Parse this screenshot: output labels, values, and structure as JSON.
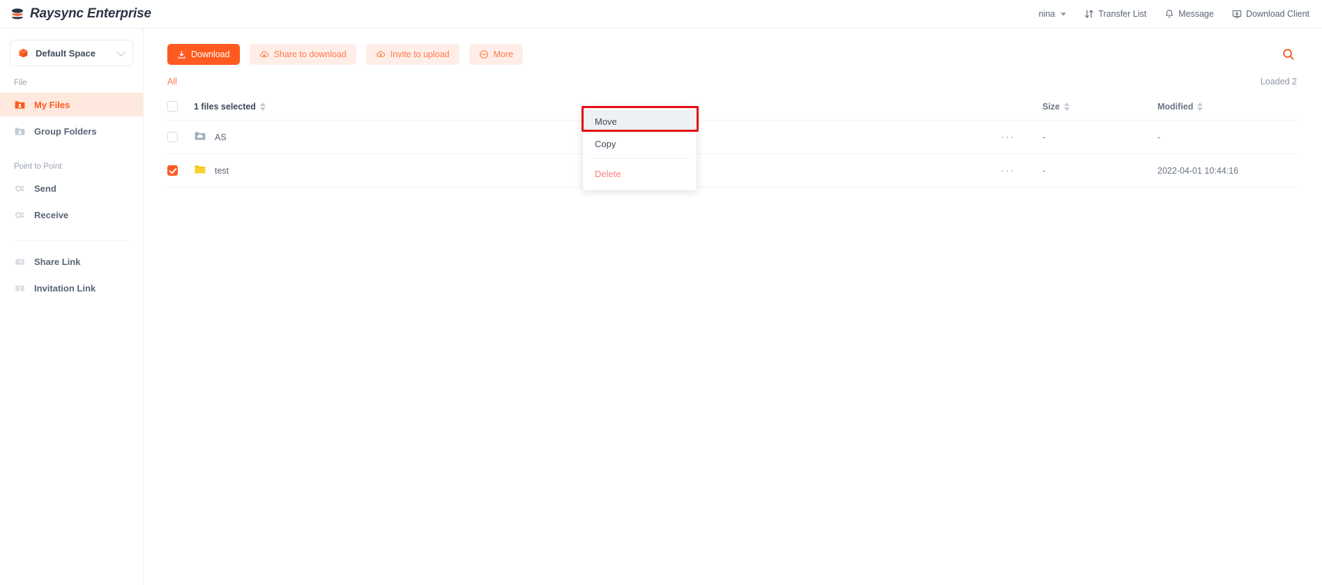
{
  "header": {
    "brand": "Raysync Enterprise",
    "brand_logo_icon": "raysync-stack-icon",
    "user": {
      "name": "nina",
      "caret_icon": "chevron-down-icon"
    },
    "nav": [
      {
        "label": "Transfer List",
        "icon": "transfer-arrows-icon"
      },
      {
        "label": "Message",
        "icon": "bell-icon"
      },
      {
        "label": "Download Client",
        "icon": "monitor-download-icon"
      }
    ]
  },
  "sidebar": {
    "space": {
      "label": "Default Space",
      "icon": "cube-icon",
      "caret_icon": "chevron-down-icon"
    },
    "sections": [
      {
        "label": "File",
        "items": [
          {
            "label": "My Files",
            "icon": "folder-user-icon",
            "active": true
          },
          {
            "label": "Group Folders",
            "icon": "folder-group-icon",
            "active": false
          }
        ]
      },
      {
        "label": "Point to Point",
        "items": [
          {
            "label": "Send",
            "icon": "send-node-icon",
            "active": false
          },
          {
            "label": "Receive",
            "icon": "receive-node-icon",
            "active": false
          }
        ]
      }
    ],
    "links": [
      {
        "label": "Share Link",
        "icon": "share-link-icon"
      },
      {
        "label": "Invitation Link",
        "icon": "invitation-link-icon"
      }
    ]
  },
  "toolbar": {
    "buttons": [
      {
        "label": "Download",
        "icon": "download-icon",
        "style": "primary"
      },
      {
        "label": "Share to download",
        "icon": "cloud-down-icon",
        "style": "soft"
      },
      {
        "label": "Invite to upload",
        "icon": "cloud-up-icon",
        "style": "soft"
      },
      {
        "label": "More",
        "icon": "minus-circle-icon",
        "style": "soft"
      }
    ],
    "search_icon": "search-icon"
  },
  "more_menu": {
    "items": [
      {
        "label": "Move",
        "highlighted": true,
        "danger": false
      },
      {
        "label": "Copy",
        "highlighted": false,
        "danger": false
      },
      {
        "label": "Delete",
        "highlighted": false,
        "danger": true
      }
    ]
  },
  "filter_bar": {
    "all_label": "All",
    "loaded_label": "Loaded 2"
  },
  "table": {
    "headers": {
      "name": "1 files selected",
      "size": "Size",
      "modified": "Modified"
    },
    "rows": [
      {
        "name": "AS",
        "icon": "cloud-folder-icon",
        "checked": false,
        "size": "-",
        "modified": "-",
        "more_icon": "ellipsis-icon"
      },
      {
        "name": "test",
        "icon": "folder-icon",
        "checked": true,
        "size": "-",
        "modified": "2022-04-01 10:44:16",
        "more_icon": "ellipsis-icon"
      }
    ]
  },
  "colors": {
    "accent": "#ff5a1f",
    "accent_soft_bg": "#ffeee7",
    "accent_soft_text": "#ff7a4d",
    "danger": "#ff7d7d",
    "annotation": "#e50914",
    "text": "#5a6475",
    "folder_yellow": "#f7c200",
    "cloud_folder_blue": "#9fb0c4"
  }
}
